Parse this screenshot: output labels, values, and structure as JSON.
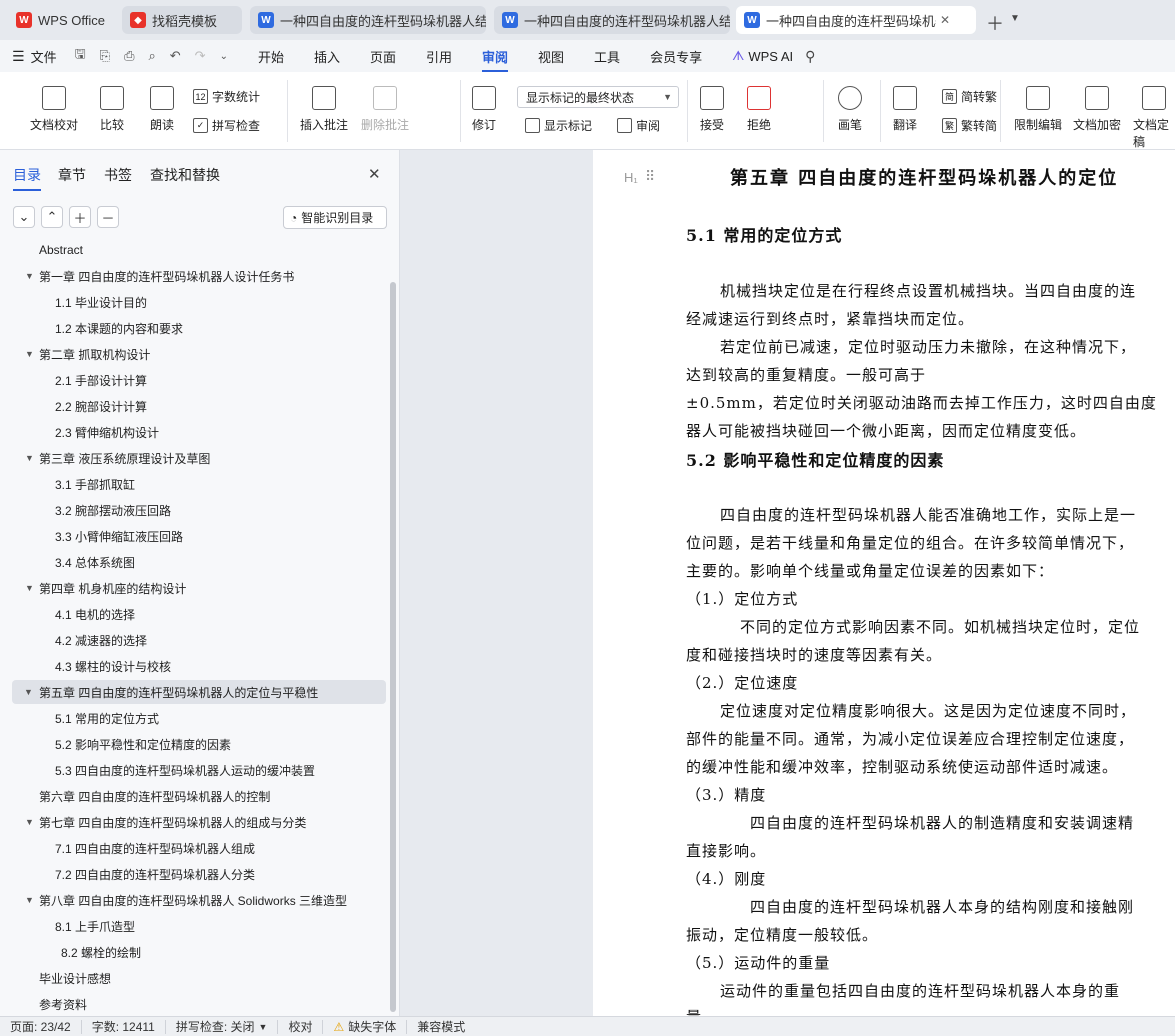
{
  "tabs": {
    "wps": "WPS Office",
    "template": "找稻壳模板",
    "doc1": "一种四自由度的连杆型码垛机器人结构",
    "doc2": "一种四自由度的连杆型码垛机器人结构",
    "doc3": "一种四自由度的连杆型码垛机器人"
  },
  "menubar": {
    "file": "文件",
    "items": [
      "开始",
      "插入",
      "页面",
      "引用",
      "审阅",
      "视图",
      "工具",
      "会员专享"
    ],
    "wps_ai": "WPS AI"
  },
  "ribbon": {
    "doc_proof": "文档校对",
    "compare": "比较",
    "read": "朗读",
    "word_count": "字数统计",
    "spell_check": "拼写检查",
    "insert_comment": "插入批注",
    "delete_comment": "删除批注",
    "track": "修订",
    "markup_state": "显示标记的最终状态",
    "show_markup": "显示标记",
    "review": "审阅",
    "accept": "接受",
    "reject": "拒绝",
    "pen": "画笔",
    "translate": "翻译",
    "trad_simp": "简转繁",
    "simp_trad": "繁转简",
    "restrict_edit": "限制编辑",
    "doc_encrypt": "文档加密",
    "doc_final": "文档定稿"
  },
  "sidebar": {
    "tabs": [
      "目录",
      "章节",
      "书签",
      "查找和替换"
    ],
    "smart_toc": "智能识别目录",
    "toc": [
      "Abstract",
      "第一章  四自由度的连杆型码垛机器人设计任务书",
      "1.1 毕业设计目的",
      "1.2 本课题的内容和要求",
      "第二章  抓取机构设计",
      "2.1 手部设计计算",
      "2.2 腕部设计计算",
      "2.3 臂伸缩机构设计",
      "第三章  液压系统原理设计及草图",
      "3.1 手部抓取缸",
      "3.2 腕部摆动液压回路",
      "3.3 小臂伸缩缸液压回路",
      "3.4 总体系统图",
      "第四章  机身机座的结构设计",
      "4.1 电机的选择",
      "4.2 减速器的选择",
      "4.3 螺柱的设计与校核",
      "第五章  四自由度的连杆型码垛机器人的定位与平稳性",
      "5.1 常用的定位方式",
      "5.2 影响平稳性和定位精度的因素",
      "5.3 四自由度的连杆型码垛机器人运动的缓冲装置",
      "第六章  四自由度的连杆型码垛机器人的控制",
      "第七章  四自由度的连杆型码垛机器人的组成与分类",
      "7.1 四自由度的连杆型码垛机器人组成",
      "7.2 四自由度的连杆型码垛机器人分类",
      "第八章  四自由度的连杆型码垛机器人 Solidworks 三维造型",
      "8.1 上手爪造型",
      "8.2 螺栓的绘制",
      "毕业设计感想",
      "参考资料"
    ]
  },
  "document": {
    "heading_marker": "H₁",
    "lines": [
      "第五章  四自由度的连杆型码垛机器人的定位",
      "5.1 常用的定位方式",
      "机械挡块定位是在行程终点设置机械挡块。当四自由度的连",
      "经减速运行到终点时，紧靠挡块而定位。",
      "若定位前已减速，定位时驱动压力未撤除，在这种情况下，",
      "达到较高的重复精度。一般可高于",
      "±0.5mm，若定位时关闭驱动油路而去掉工作压力，这时四自由度",
      "器人可能被挡块碰回一个微小距离，因而定位精度变低。",
      "5.2 影响平稳性和定位精度的因素",
      "四自由度的连杆型码垛机器人能否准确地工作，实际上是一",
      "位问题，是若干线量和角量定位的组合。在许多较简单情况下，",
      "主要的。影响单个线量或角量定位误差的因素如下：",
      "（1.）定位方式",
      "不同的定位方式影响因素不同。如机械挡块定位时，定位",
      "度和碰接挡块时的速度等因素有关。",
      "（2.）定位速度",
      "定位速度对定位精度影响很大。这是因为定位速度不同时，",
      "部件的能量不同。通常，为减小定位误差应合理控制定位速度，",
      "的缓冲性能和缓冲效率，控制驱动系统使运动部件适时减速。",
      "（3.）精度",
      "四自由度的连杆型码垛机器人的制造精度和安装调速精",
      "直接影响。",
      "（4.）刚度",
      "四自由度的连杆型码垛机器人本身的结构刚度和接触刚",
      "振动，定位精度一般较低。",
      "（5.）运动件的重量",
      "运动件的重量包括四自由度的连杆型码垛机器人本身的重",
      "量"
    ]
  },
  "status": {
    "page": "页面: 23/42",
    "words": "字数: 12411",
    "spell": "拼写检查: 关闭",
    "proof": "校对",
    "missing_font": "缺失字体",
    "compat": "兼容模式"
  }
}
